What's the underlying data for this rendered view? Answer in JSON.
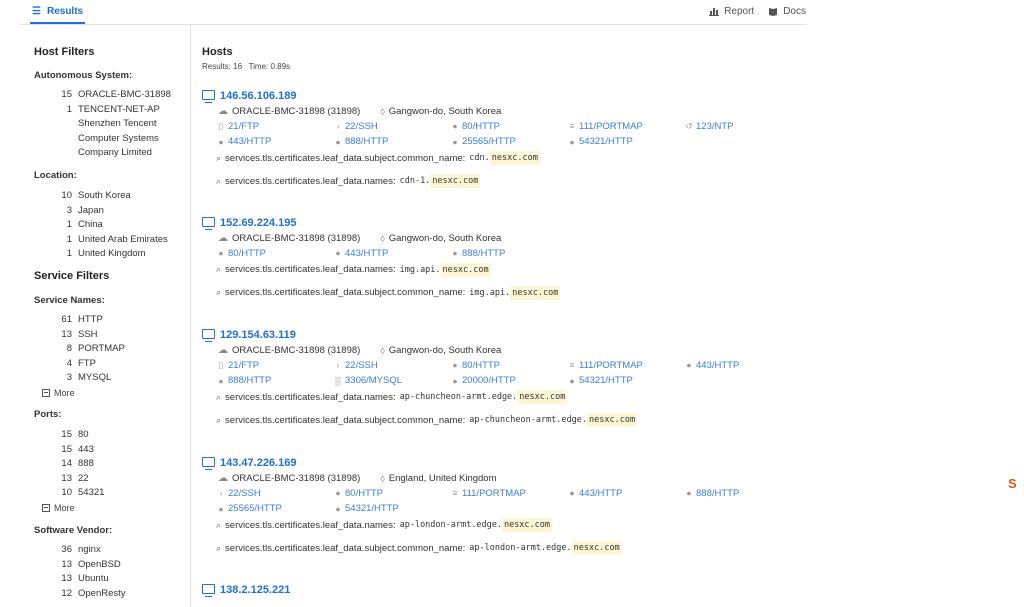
{
  "topbar": {
    "tab_results": "Results",
    "report": "Report",
    "docs": "Docs"
  },
  "sidebar": {
    "host_filters": "Host Filters",
    "autonomous_system": {
      "title": "Autonomous System:",
      "items": [
        {
          "count": "15",
          "label": "ORACLE-BMC-31898"
        },
        {
          "count": "1",
          "label": "TENCENT-NET-AP"
        },
        {
          "count": "",
          "label": "Shenzhen Tencent"
        },
        {
          "count": "",
          "label": "Computer Systems"
        },
        {
          "count": "",
          "label": "Company Limited"
        }
      ]
    },
    "location": {
      "title": "Location:",
      "items": [
        {
          "count": "10",
          "label": "South Korea"
        },
        {
          "count": "3",
          "label": "Japan"
        },
        {
          "count": "1",
          "label": "China"
        },
        {
          "count": "1",
          "label": "United Arab Emirates"
        },
        {
          "count": "1",
          "label": "United Kingdom"
        }
      ]
    },
    "service_filters": "Service Filters",
    "service_names": {
      "title": "Service Names:",
      "items": [
        {
          "count": "61",
          "label": "HTTP"
        },
        {
          "count": "13",
          "label": "SSH"
        },
        {
          "count": "8",
          "label": "PORTMAP"
        },
        {
          "count": "4",
          "label": "FTP"
        },
        {
          "count": "3",
          "label": "MYSQL"
        }
      ],
      "more": "More"
    },
    "ports": {
      "title": "Ports:",
      "items": [
        {
          "count": "15",
          "label": "80"
        },
        {
          "count": "15",
          "label": "443"
        },
        {
          "count": "14",
          "label": "888"
        },
        {
          "count": "13",
          "label": "22"
        },
        {
          "count": "10",
          "label": "54321"
        }
      ],
      "more": "More"
    },
    "software_vendor": {
      "title": "Software Vendor:",
      "items": [
        {
          "count": "36",
          "label": "nginx"
        },
        {
          "count": "13",
          "label": "OpenBSD"
        },
        {
          "count": "13",
          "label": "Ubuntu"
        },
        {
          "count": "12",
          "label": "OpenResty"
        }
      ]
    }
  },
  "main": {
    "title": "Hosts",
    "results": "Results: 16",
    "time": "Time: 0.89s",
    "hosts": [
      {
        "ip": "146.56.106.189",
        "asn": "ORACLE-BMC-31898 (31898)",
        "location": "Gangwon-do, South Korea",
        "services": [
          "21/FTP",
          "22/SSH",
          "80/HTTP",
          "111/PORTMAP",
          "123/NTP",
          "443/HTTP",
          "888/HTTP",
          "25565/HTTP",
          "54321/HTTP"
        ],
        "matches": [
          {
            "field": "services.tls.certificates.leaf_data.subject.common_name:",
            "pre": "cdn.",
            "hl": "nesxc.com"
          },
          {
            "field": "services.tls.certificates.leaf_data.names:",
            "pre": "cdn-1.",
            "hl": "nesxc.com"
          }
        ]
      },
      {
        "ip": "152.69.224.195",
        "asn": "ORACLE-BMC-31898 (31898)",
        "location": "Gangwon-do, South Korea",
        "services": [
          "80/HTTP",
          "443/HTTP",
          "888/HTTP"
        ],
        "matches": [
          {
            "field": "services.tls.certificates.leaf_data.names:",
            "pre": "img.api.",
            "hl": "nesxc.com"
          },
          {
            "field": "services.tls.certificates.leaf_data.subject.common_name:",
            "pre": "img.api.",
            "hl": "nesxc.com"
          }
        ]
      },
      {
        "ip": "129.154.63.119",
        "asn": "ORACLE-BMC-31898 (31898)",
        "location": "Gangwon-do, South Korea",
        "services": [
          "21/FTP",
          "22/SSH",
          "80/HTTP",
          "111/PORTMAP",
          "443/HTTP",
          "888/HTTP",
          "3306/MYSQL",
          "20000/HTTP",
          "54321/HTTP"
        ],
        "matches": [
          {
            "field": "services.tls.certificates.leaf_data.names:",
            "pre": "ap-chuncheon-armt.edge.",
            "hl": "nesxc.com"
          },
          {
            "field": "services.tls.certificates.leaf_data.subject.common_name:",
            "pre": "ap-chuncheon-armt.edge.",
            "hl": "nesxc.com"
          }
        ]
      },
      {
        "ip": "143.47.226.169",
        "asn": "ORACLE-BMC-31898 (31898)",
        "location": "England, United Kingdom",
        "services": [
          "22/SSH",
          "80/HTTP",
          "111/PORTMAP",
          "443/HTTP",
          "888/HTTP",
          "25565/HTTP",
          "54321/HTTP"
        ],
        "matches": [
          {
            "field": "services.tls.certificates.leaf_data.names:",
            "pre": "ap-london-armt.edge.",
            "hl": "nesxc.com"
          },
          {
            "field": "services.tls.certificates.leaf_data.subject.common_name:",
            "pre": "ap-london-armt.edge.",
            "hl": "nesxc.com"
          }
        ]
      },
      {
        "ip": "138.2.125.221",
        "asn": "",
        "location": "",
        "services": [],
        "matches": []
      }
    ]
  }
}
